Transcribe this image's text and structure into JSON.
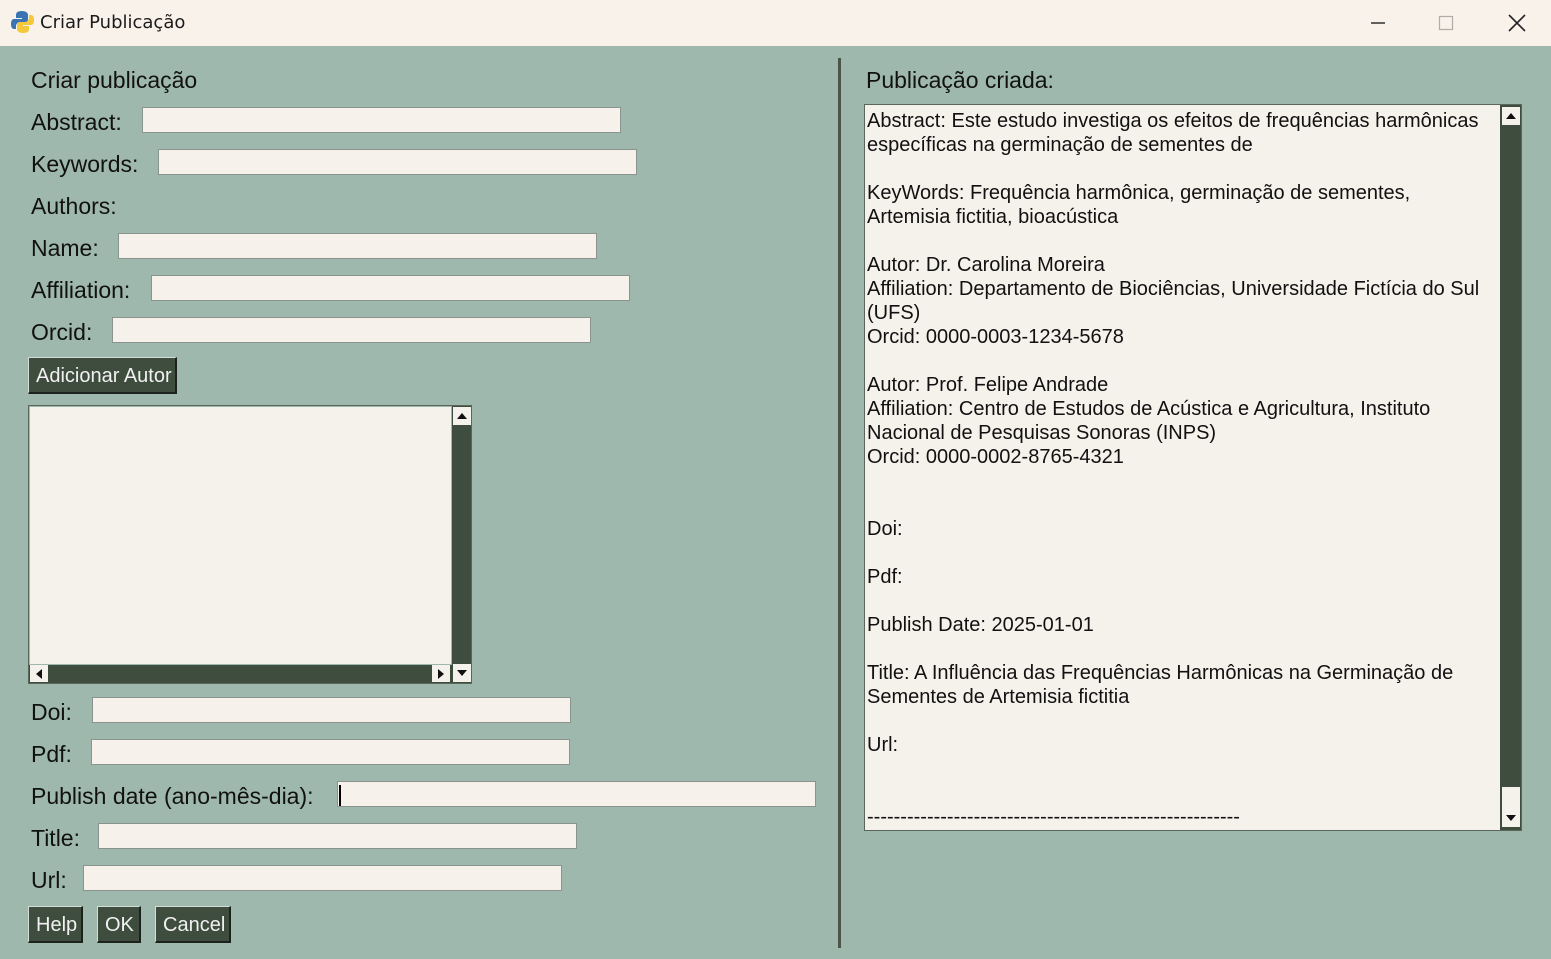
{
  "window": {
    "title": "Criar Publicação"
  },
  "form": {
    "heading": "Criar publicação",
    "abstract_label": "Abstract:",
    "keywords_label": "Keywords:",
    "authors_label": "Authors:",
    "name_label": "Name:",
    "affiliation_label": "Affiliation:",
    "orcid_label": "Orcid:",
    "add_author_button": "Adicionar Autor",
    "doi_label": "Doi:",
    "pdf_label": "Pdf:",
    "publish_date_label": "Publish date (ano-mês-dia):",
    "title_label": "Title:",
    "url_label": "Url:",
    "help_button": "Help",
    "ok_button": "OK",
    "cancel_button": "Cancel"
  },
  "output": {
    "heading": "Publicação criada:",
    "text": "Abstract: Este estudo investiga os efeitos de frequências harmônicas específicas na germinação de sementes de\n\nKeyWords: Frequência harmônica, germinação de sementes, Artemisia fictitia, bioacústica\n\nAutor: Dr. Carolina Moreira\nAffiliation: Departamento de Biociências, Universidade Fictícia do Sul (UFS)\nOrcid: 0000-0003-1234-5678\n\nAutor: Prof. Felipe Andrade\nAffiliation: Centro de Estudos de Acústica e Agricultura, Instituto Nacional de Pesquisas Sonoras (INPS)\nOrcid: 0000-0002-8765-4321\n\n\nDoi:\n\nPdf:\n\nPublish Date: 2025-01-01\n\nTitle: A Influência das Frequências Harmônicas na Germinação de Sementes de Artemisia fictitia\n\nUrl:\n\n\n--------------------------------------------------------"
  },
  "colors": {
    "background": "#9fb8ad",
    "button": "#3f4d3e",
    "field": "#f6f1eb"
  }
}
